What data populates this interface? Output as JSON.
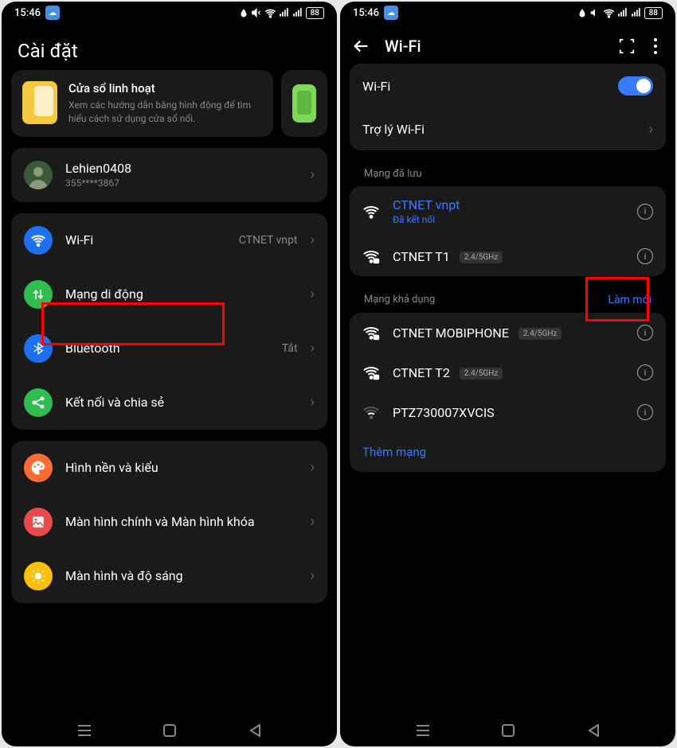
{
  "left": {
    "status": {
      "time": "15:46",
      "battery": "88"
    },
    "header": "Cài đặt",
    "promo": {
      "title": "Cửa sổ linh hoạt",
      "subtitle": "Xem các hướng dẫn bằng hình động để tìm hiểu cách sử dụng cửa sổ nổi."
    },
    "account": {
      "name": "Lehien0408",
      "id": "355****3867"
    },
    "rows": {
      "wifi": {
        "label": "Wi-Fi",
        "value": "CTNET vnpt"
      },
      "mobile": {
        "label": "Mạng di động"
      },
      "bluetooth": {
        "label": "Bluetooth",
        "value": "Tắt"
      },
      "share": {
        "label": "Kết nối và chia sẻ"
      },
      "wallpaper": {
        "label": "Hình nền và kiểu"
      },
      "homescreen": {
        "label": "Màn hình chính và Màn hình khóa"
      },
      "display": {
        "label": "Màn hình và độ sáng"
      }
    }
  },
  "right": {
    "status": {
      "time": "15:46",
      "battery": "88"
    },
    "header": "Wi-Fi",
    "toggle": {
      "label": "Wi-Fi"
    },
    "assistant": {
      "label": "Trợ lý Wi-Fi"
    },
    "sections": {
      "saved": "Mạng đã lưu",
      "available": "Mạng khả dụng",
      "refresh": "Làm mới"
    },
    "networks": {
      "saved": [
        {
          "name": "CTNET vnpt",
          "status": "Đã kết nối",
          "connected": true
        },
        {
          "name": "CTNET T1",
          "band": "2.4/5GHz"
        }
      ],
      "available": [
        {
          "name": "CTNET MOBIPHONE",
          "band": "2.4/5GHz",
          "locked": true
        },
        {
          "name": "CTNET T2",
          "band": "2.4/5GHz",
          "locked": true
        },
        {
          "name": "PTZ730007XVCIS",
          "weak": true
        }
      ]
    },
    "addMore": "Thêm mạng"
  }
}
